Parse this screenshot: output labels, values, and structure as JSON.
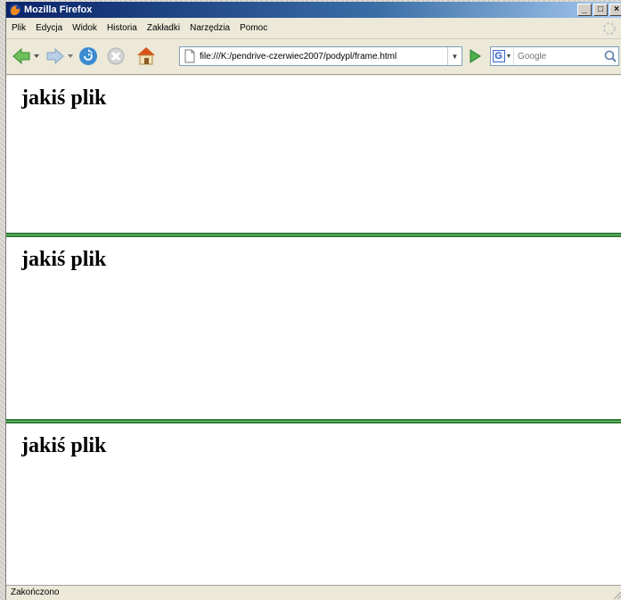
{
  "window": {
    "title": "Mozilla Firefox",
    "buttons": {
      "minimize": "_",
      "maximize": "□",
      "close": "×"
    }
  },
  "menu": {
    "items": [
      "Plik",
      "Edycja",
      "Widok",
      "Historia",
      "Zakładki",
      "Narzędzia",
      "Pomoc"
    ]
  },
  "navigation": {
    "back_icon": "back-arrow-icon",
    "forward_icon": "forward-arrow-icon",
    "reload_icon": "reload-icon",
    "stop_icon": "stop-icon",
    "home_icon": "home-icon",
    "url": "file:///K:/pendrive-czerwiec2007/podypl/frame.html",
    "search_placeholder": "Google"
  },
  "frames": [
    {
      "heading": "jakiś plik"
    },
    {
      "heading": "jakiś plik"
    },
    {
      "heading": "jakiś plik"
    }
  ],
  "status": {
    "text": "Zakończono"
  },
  "colors": {
    "frame_border": "#2e7d32",
    "titlebar_start": "#0a246a",
    "titlebar_end": "#a6caf0"
  }
}
